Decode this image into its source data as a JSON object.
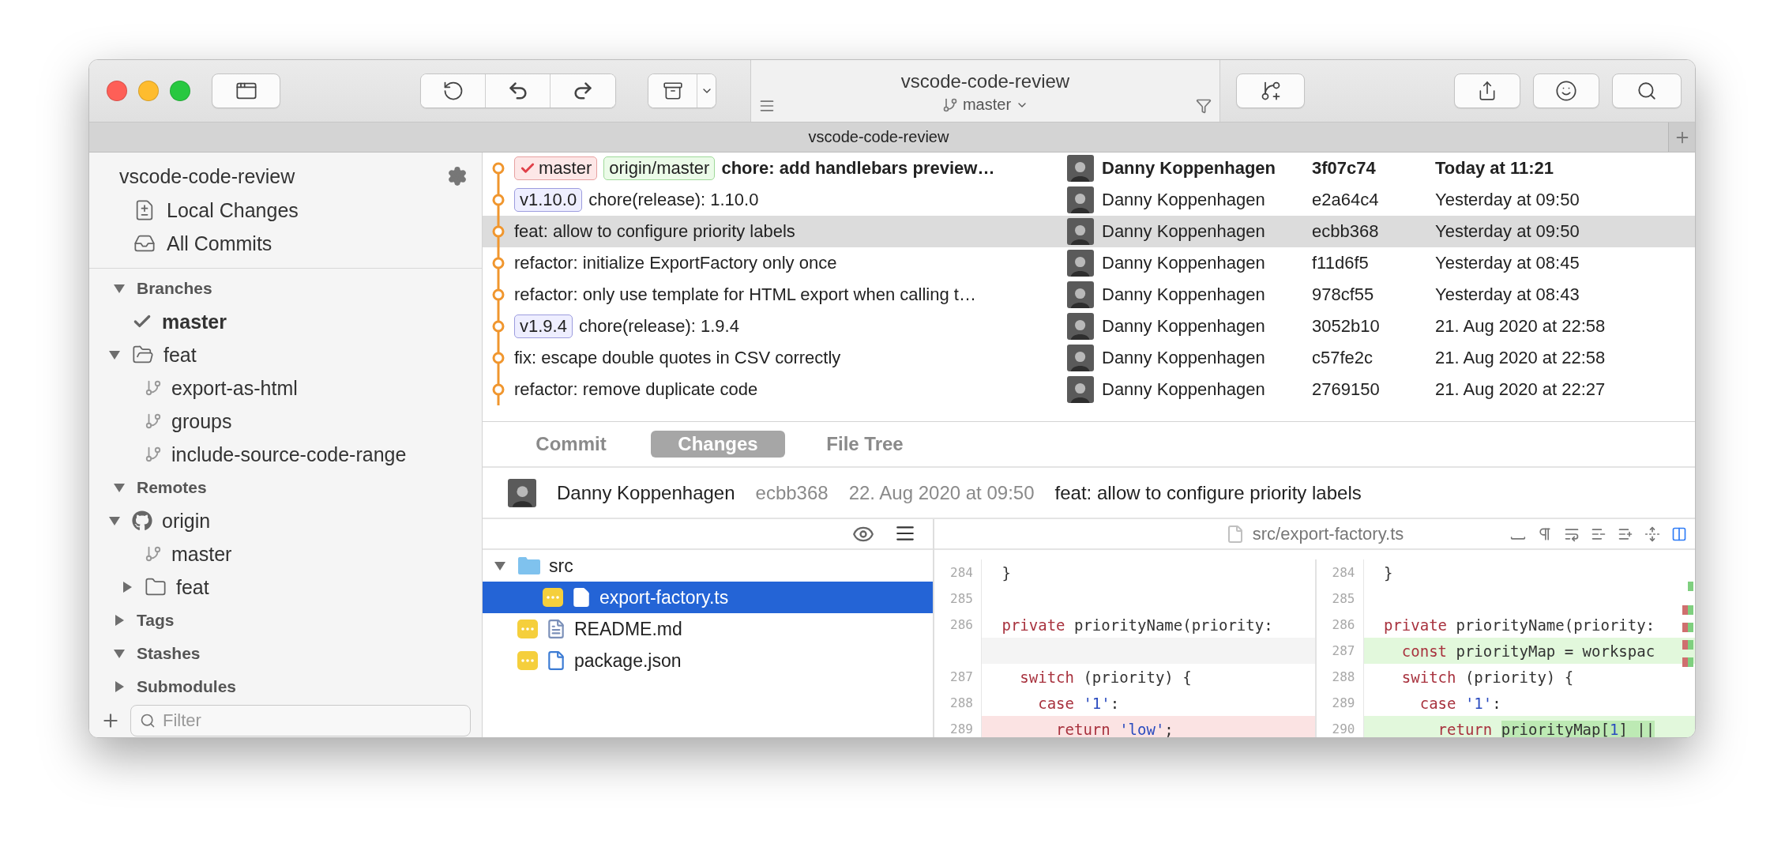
{
  "toolbar": {
    "title": "vscode-code-review",
    "branch": "master"
  },
  "tab_bar": {
    "tabs": [
      {
        "label": "vscode-code-review"
      }
    ]
  },
  "sidebar": {
    "repository": "vscode-code-review",
    "views": [
      {
        "label": "Local Changes",
        "kind": "changes"
      },
      {
        "label": "All Commits",
        "kind": "commits"
      }
    ],
    "sections": [
      {
        "title": "Branches",
        "expanded": true,
        "items": [
          {
            "kind": "branch",
            "label": "master",
            "current": true
          },
          {
            "kind": "folder",
            "label": "feat",
            "expanded": true,
            "children": [
              {
                "kind": "branch",
                "label": "export-as-html",
                "current": false
              },
              {
                "kind": "branch",
                "label": "groups",
                "current": false
              },
              {
                "kind": "branch",
                "label": "include-source-code-range",
                "current": false
              }
            ]
          }
        ]
      },
      {
        "title": "Remotes",
        "expanded": true,
        "items": [
          {
            "kind": "remote",
            "label": "origin",
            "expanded": true,
            "children": [
              {
                "kind": "branch",
                "label": "master",
                "current": false
              },
              {
                "kind": "folder",
                "label": "feat",
                "expanded": false
              }
            ]
          }
        ]
      },
      {
        "title": "Tags",
        "expanded": false
      },
      {
        "title": "Stashes",
        "expanded": true
      },
      {
        "title": "Submodules",
        "expanded": false
      }
    ],
    "filter": {
      "placeholder": "Filter"
    }
  },
  "commits": [
    {
      "refs": [
        {
          "label": "master",
          "kind": "local"
        },
        {
          "label": "origin/master",
          "kind": "remote"
        }
      ],
      "subject": "chore: add handlebars preview…",
      "author": "Danny Koppenhagen",
      "sha": "3f07c74",
      "date": "Today at 11:21",
      "head": true,
      "selected": false
    },
    {
      "refs": [
        {
          "label": "v1.10.0",
          "kind": "tag"
        }
      ],
      "subject": "chore(release): 1.10.0",
      "author": "Danny Koppenhagen",
      "sha": "e2a64c4",
      "date": "Yesterday at 09:50",
      "head": false,
      "selected": false
    },
    {
      "subject": "feat: allow to configure priority labels",
      "author": "Danny Koppenhagen",
      "sha": "ecbb368",
      "date": "Yesterday at 09:50",
      "head": false,
      "selected": true
    },
    {
      "subject": "refactor: initialize ExportFactory only once",
      "author": "Danny Koppenhagen",
      "sha": "f11d6f5",
      "date": "Yesterday at 08:45",
      "head": false,
      "selected": false
    },
    {
      "subject": "refactor: only use template for HTML export when calling t…",
      "author": "Danny Koppenhagen",
      "sha": "978cf55",
      "date": "Yesterday at 08:43",
      "head": false,
      "selected": false
    },
    {
      "refs": [
        {
          "label": "v1.9.4",
          "kind": "tag"
        }
      ],
      "subject": "chore(release): 1.9.4",
      "author": "Danny Koppenhagen",
      "sha": "3052b10",
      "date": "21. Aug 2020 at 22:58",
      "head": false,
      "selected": false
    },
    {
      "subject": "fix: escape double quotes in CSV correctly",
      "author": "Danny Koppenhagen",
      "sha": "c57fe2c",
      "date": "21. Aug 2020 at 22:58",
      "head": false,
      "selected": false
    },
    {
      "subject": "refactor: remove duplicate code",
      "author": "Danny Koppenhagen",
      "sha": "2769150",
      "date": "21. Aug 2020 at 22:27",
      "head": false,
      "selected": false
    }
  ],
  "detail_tabs": [
    {
      "label": "Commit",
      "selected": false
    },
    {
      "label": "Changes",
      "selected": true
    },
    {
      "label": "File Tree",
      "selected": false
    }
  ],
  "commit_info": {
    "author": "Danny Koppenhagen",
    "sha": "ecbb368",
    "date": "22. Aug 2020 at 09:50",
    "subject": "feat: allow to configure priority labels"
  },
  "files": [
    {
      "kind": "folder",
      "name": "src",
      "expanded": true,
      "children": [
        {
          "kind": "source",
          "name": "export-factory.ts",
          "selected": true
        }
      ]
    },
    {
      "kind": "markdown",
      "name": "README.md",
      "selected": false
    },
    {
      "kind": "json",
      "name": "package.json",
      "selected": false
    }
  ],
  "diff": {
    "path": "src/export-factory.ts",
    "left": [
      {
        "number": "284",
        "kind": "context",
        "tokens": [
          {
            "text": " }",
            "kind": "plain"
          }
        ]
      },
      {
        "number": "285",
        "kind": "context"
      },
      {
        "number": "286",
        "kind": "context",
        "tokens": [
          {
            "text": " private",
            "kind": "keyword"
          },
          {
            "text": " priorityName(priority:",
            "kind": "plain"
          }
        ]
      },
      {
        "kind": "placeholder"
      },
      {
        "number": "287",
        "kind": "context",
        "tokens": [
          {
            "text": "   switch",
            "kind": "keyword"
          },
          {
            "text": " (priority) {",
            "kind": "plain"
          }
        ]
      },
      {
        "number": "288",
        "kind": "context",
        "tokens": [
          {
            "text": "     case",
            "kind": "keyword"
          },
          {
            "text": " '1'",
            "kind": "string"
          },
          {
            "text": ":",
            "kind": "plain"
          }
        ]
      },
      {
        "number": "289",
        "kind": "removed",
        "tokens": [
          {
            "text": "       return",
            "kind": "keyword"
          },
          {
            "text": " 'low'",
            "kind": "string"
          },
          {
            "text": ";",
            "kind": "plain"
          }
        ]
      }
    ],
    "right": [
      {
        "number": "284",
        "kind": "context",
        "tokens": [
          {
            "text": " }",
            "kind": "plain"
          }
        ]
      },
      {
        "number": "285",
        "kind": "context"
      },
      {
        "number": "286",
        "kind": "context",
        "tokens": [
          {
            "text": " private",
            "kind": "keyword"
          },
          {
            "text": " priorityName(priority:",
            "kind": "plain"
          }
        ]
      },
      {
        "number": "287",
        "kind": "added",
        "tokens": [
          {
            "text": "   const",
            "kind": "keyword"
          },
          {
            "text": " priorityMap = workspac",
            "kind": "plain"
          }
        ]
      },
      {
        "number": "288",
        "kind": "context",
        "tokens": [
          {
            "text": "   switch",
            "kind": "keyword"
          },
          {
            "text": " (priority) {",
            "kind": "plain"
          }
        ]
      },
      {
        "number": "289",
        "kind": "context",
        "tokens": [
          {
            "text": "     case",
            "kind": "keyword"
          },
          {
            "text": " '1'",
            "kind": "string"
          },
          {
            "text": ":",
            "kind": "plain"
          }
        ]
      },
      {
        "number": "290",
        "kind": "added",
        "tokens": [
          {
            "text": "       return ",
            "kind": "keyword"
          },
          {
            "text": "priorityMap[",
            "kind": "mark"
          },
          {
            "text": "1",
            "kind": "mark-number"
          },
          {
            "text": "] ||",
            "kind": "mark"
          }
        ]
      }
    ]
  }
}
